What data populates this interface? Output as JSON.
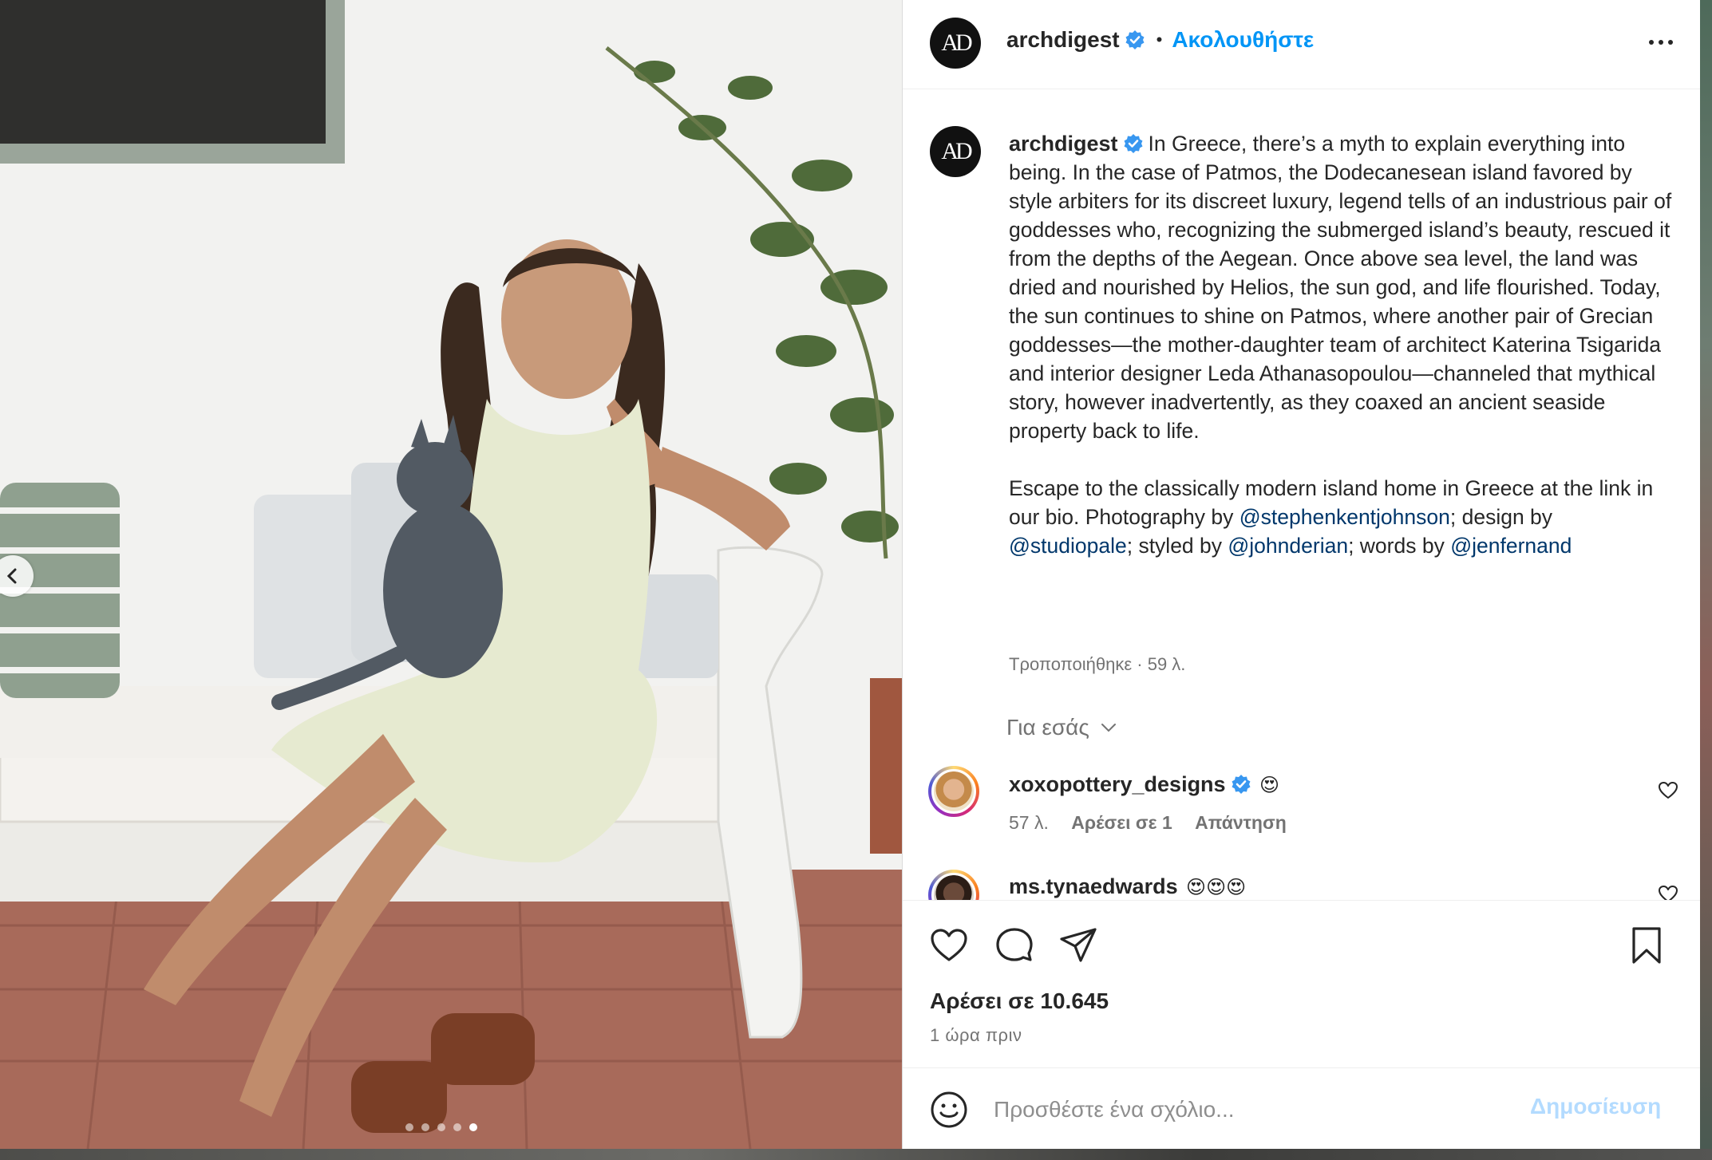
{
  "post": {
    "author": "archdigest",
    "avatar_text": "AD",
    "follow_label": "Ακολουθήστε",
    "separator": "•",
    "caption_paragraph_1": "In Greece, there’s a myth to explain everything into being. In the case of Patmos, the Dodecanesean island favored by style arbiters for its discreet luxury, legend tells of an industrious pair of goddesses who, recognizing the submerged island’s beauty, rescued it from the depths of the Aegean. Once above sea level, the land was dried and nourished by Helios, the sun god, and life flourished. Today, the sun continues to shine on Patmos, where another pair of Grecian goddesses—the mother-daughter team of architect Katerina Tsigarida and interior designer Leda Athanasopoulou—channeled that mythical story, however inadvertently, as they coaxed an ancient seaside property back to life.",
    "caption_p2_text_1": "Escape to the classically modern island home in Greece at the link in our bio. Photography by ",
    "caption_p2_mention_1": "@stephenkentjohnson",
    "caption_p2_text_2": "; design by ",
    "caption_p2_mention_2": "@studiopale",
    "caption_p2_text_3": "; styled by ",
    "caption_p2_mention_3": "@johnderian",
    "caption_p2_text_4": "; words by ",
    "caption_p2_mention_4": "@jenfernand",
    "edited_label": "Τροποποιήθηκε · 59 λ.",
    "for_you_label": "Για εσάς"
  },
  "comments": [
    {
      "user": "xoxopottery_designs",
      "text": "😍",
      "time": "57 λ.",
      "likes": "Αρέσει σε 1",
      "reply": "Απάντηση"
    },
    {
      "user": "ms.tynaedwards",
      "text": "😍😍😍"
    }
  ],
  "actions": {
    "likes_count": "Αρέσει σε 10.645",
    "time_ago": "1 ώρα πριν"
  },
  "comment_box": {
    "placeholder": "Προσθέστε ένα σχόλιο...",
    "post_label": "Δημοσίευση"
  },
  "carousel": {
    "count": 5,
    "active_index": 4
  },
  "icons": {
    "verified": "verified-badge-icon",
    "like": "heart-icon",
    "comment": "comment-bubble-icon",
    "share": "paper-plane-icon",
    "save": "bookmark-icon",
    "emoji": "smiley-icon",
    "more": "more-options-icon"
  },
  "colors": {
    "accent": "#0095f6",
    "mention": "#00376b",
    "verified": "#3897f0"
  }
}
